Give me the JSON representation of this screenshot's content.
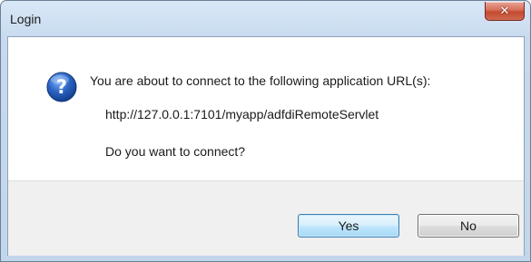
{
  "window": {
    "title": "Login",
    "close_glyph": "✕"
  },
  "message": {
    "line1": "You are about to connect to the following application URL(s):",
    "url": "http://127.0.0.1:7101/myapp/adfdiRemoteServlet",
    "question": "Do you want to connect?"
  },
  "buttons": {
    "yes_label": "Yes",
    "no_label": "No"
  },
  "icons": {
    "message_icon": "question-icon",
    "close_icon": "close-icon"
  },
  "colors": {
    "question_icon_blue": "#2a62c2",
    "close_button_red": "#c44a31",
    "default_button_border": "#3c7fb1"
  }
}
